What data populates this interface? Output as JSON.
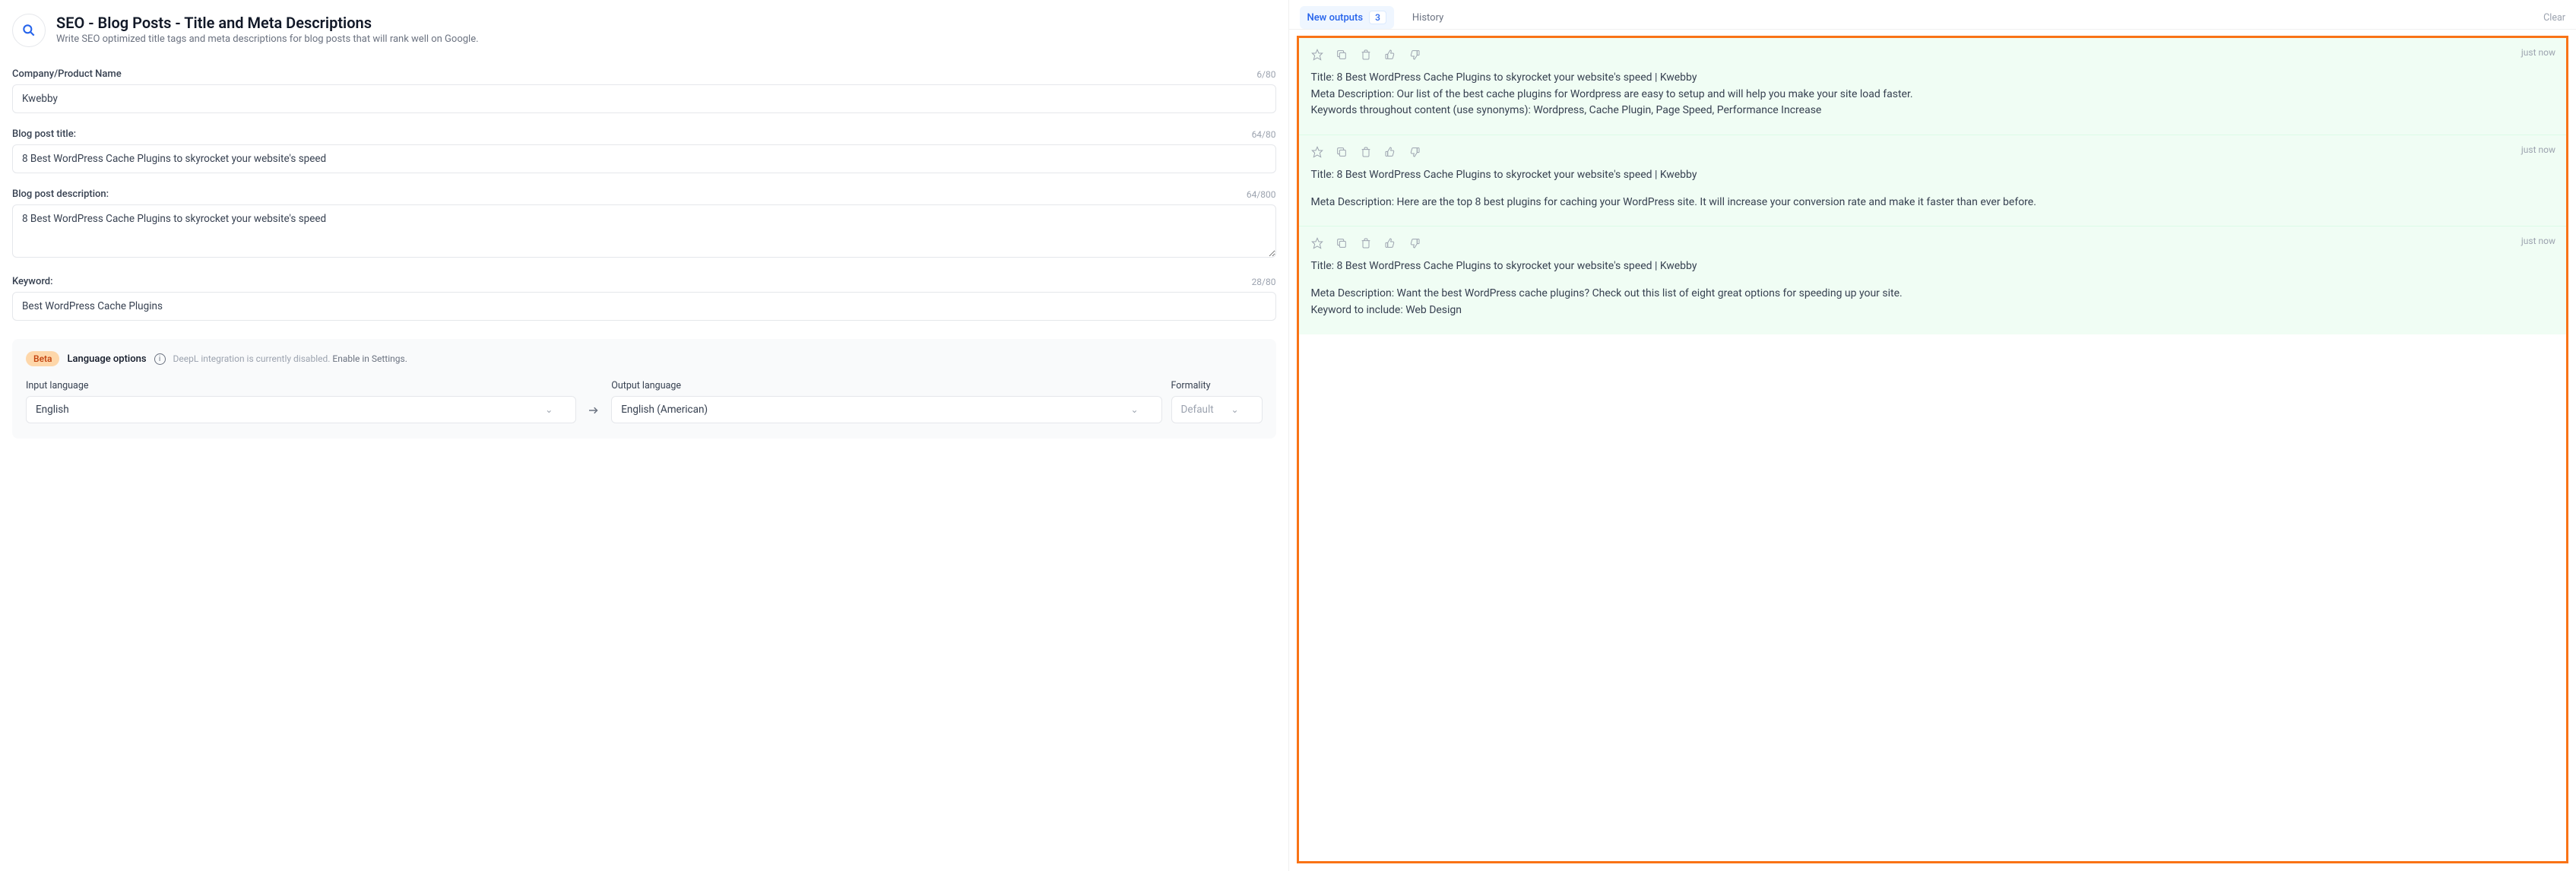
{
  "header": {
    "title": "SEO - Blog Posts - Title and Meta Descriptions",
    "description": "Write SEO optimized title tags and meta descriptions for blog posts that will rank well on Google."
  },
  "fields": {
    "company": {
      "label": "Company/Product Name",
      "value": "Kwebby",
      "count": "6/80"
    },
    "postTitle": {
      "label": "Blog post title:",
      "value": "8 Best WordPress Cache Plugins to skyrocket your website's speed",
      "count": "64/80"
    },
    "postDesc": {
      "label": "Blog post description:",
      "value": "8 Best WordPress Cache Plugins to skyrocket your website's speed",
      "count": "64/800"
    },
    "keyword": {
      "label": "Keyword:",
      "value": "Best WordPress Cache Plugins",
      "count": "28/80"
    }
  },
  "lang": {
    "beta": "Beta",
    "title": "Language options",
    "note1": "DeepL integration is currently disabled. ",
    "note2": "Enable in Settings.",
    "inputLabel": "Input language",
    "inputValue": "English",
    "outputLabel": "Output language",
    "outputValue": "English (American)",
    "formalityLabel": "Formality",
    "formalityValue": "Default"
  },
  "tabs": {
    "new": "New outputs",
    "count": "3",
    "history": "History",
    "clear": "Clear"
  },
  "outputs": [
    {
      "time": "just now",
      "lines": [
        "Title: 8 Best WordPress Cache Plugins to skyrocket your website's speed | Kwebby",
        "Meta Description: Our list of the best cache plugins for Wordpress are easy to setup and will help you make your site load faster.",
        "Keywords throughout content (use synonyms): Wordpress, Cache Plugin, Page Speed, Performance Increase"
      ],
      "gaps": [
        false,
        false,
        false
      ]
    },
    {
      "time": "just now",
      "lines": [
        "Title: 8 Best WordPress Cache Plugins to skyrocket your website's speed | Kwebby",
        "Meta Description: Here are the top 8 best plugins for caching your WordPress site. It will increase your conversion rate and make it faster than ever before."
      ],
      "gaps": [
        false,
        true
      ]
    },
    {
      "time": "just now",
      "lines": [
        "Title: 8 Best WordPress Cache Plugins to skyrocket your website's speed | Kwebby",
        "Meta Description: Want the best WordPress cache plugins? Check out this list of eight great options for speeding up your site.",
        "Keyword to include: Web Design"
      ],
      "gaps": [
        false,
        true,
        false
      ]
    }
  ]
}
